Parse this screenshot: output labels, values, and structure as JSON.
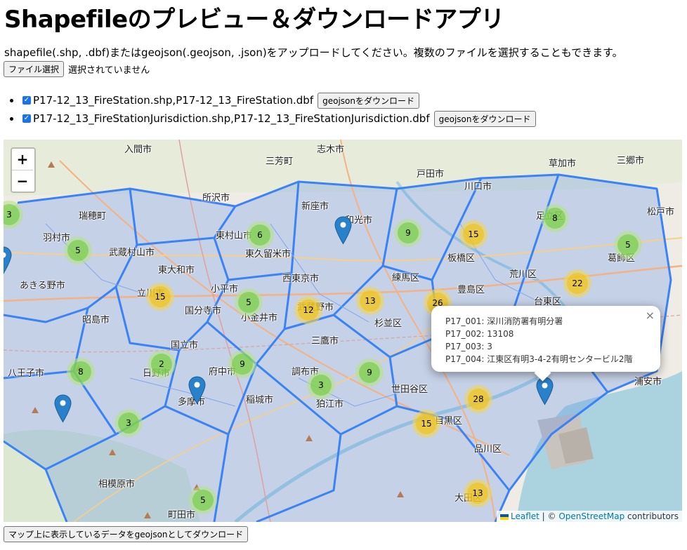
{
  "page": {
    "title": "Shapefileのプレビュー＆ダウンロードアプリ",
    "description": "shapefile(.shp, .dbf)またはgeojson(.geojson, .json)をアップロードしてください。複数のファイルを選択することもできます。",
    "file_button": "ファイル選択",
    "no_file": "選択されていません",
    "download_all": "マップ上に表示しているデータをgeojsonとしてダウンロード"
  },
  "files": [
    {
      "name": "P17-12_13_FireStation.shp,P17-12_13_FireStation.dbf",
      "checked": true,
      "button": "geojsonをダウンロード"
    },
    {
      "name": "P17-12_13_FireStationJurisdiction.shp,P17-12_13_FireStationJurisdiction.dbf",
      "checked": true,
      "button": "geojsonをダウンロード"
    }
  ],
  "map": {
    "zoom_in": "+",
    "zoom_out": "−",
    "clusters": [
      "3",
      "5",
      "6",
      "9",
      "15",
      "8",
      "5",
      "15",
      "5",
      "12",
      "13",
      "26",
      "22",
      "8",
      "2",
      "9",
      "3",
      "9",
      "28",
      "3",
      "15",
      "13",
      "5"
    ],
    "place_labels": [
      "入間市",
      "志木市",
      "三芳町",
      "戸田市",
      "草加市",
      "三郷市",
      "川口市",
      "所沢市",
      "新座市",
      "和光市",
      "瑞穂町",
      "羽村市",
      "東村山市",
      "東久留米市",
      "板橋区",
      "武蔵村山市",
      "東大和市",
      "西東京市",
      "練馬区",
      "荒川区",
      "あきる野市",
      "立川市",
      "小平市",
      "国分寺市",
      "小金井市",
      "武蔵野市",
      "杉並区",
      "豊島区",
      "台東区",
      "昭島市",
      "三鷹市",
      "国立市",
      "府中市",
      "調布市",
      "八王子市",
      "日野市",
      "多摩市",
      "稲城市",
      "狛江市",
      "世田谷区",
      "浦安市",
      "目黒区",
      "品川区",
      "相模原市",
      "町田市",
      "大田区",
      "足立区",
      "葛飾区",
      "松戸市"
    ],
    "popup": {
      "lines": [
        "P17_001: 深川消防署有明分署",
        "P17_002: 13108",
        "P17_003: 3",
        "P17_004: 江東区有明3-4-2有明センタービル2階"
      ],
      "close": "×"
    },
    "attribution": {
      "leaflet": "Leaflet",
      "sep": " | © ",
      "osm": "OpenStreetMap",
      "suffix": " contributors"
    }
  },
  "colors": {
    "cluster_green": "#6ecc39",
    "cluster_yellow": "#f0c20c",
    "boundary": "#3b82f6",
    "water": "#aad3df",
    "pin": "#2a81cb"
  }
}
